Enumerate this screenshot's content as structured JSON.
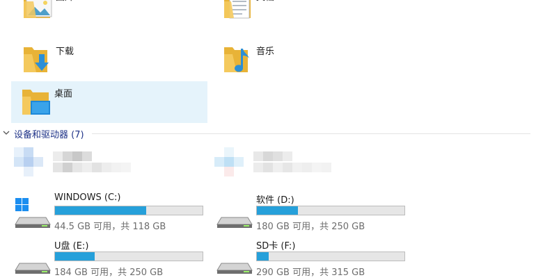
{
  "folders": [
    {
      "label": "图片",
      "icon": "pictures-folder-icon"
    },
    {
      "label": "文档",
      "icon": "documents-folder-icon"
    },
    {
      "label": "下载",
      "icon": "downloads-folder-icon"
    },
    {
      "label": "音乐",
      "icon": "music-folder-icon"
    },
    {
      "label": "桌面",
      "icon": "desktop-folder-icon",
      "selected": true
    }
  ],
  "devices_section": {
    "title": "设备和驱动器 (7)"
  },
  "drives": [
    {
      "name": "WINDOWS (C:)",
      "space": "44.5 GB 可用，共 118 GB",
      "used_fraction": 0.62,
      "icon": "windows-drive-icon"
    },
    {
      "name": "软件 (D:)",
      "space": "180 GB 可用，共 250 GB",
      "used_fraction": 0.28,
      "icon": "hard-drive-icon"
    },
    {
      "name": "U盘 (E:)",
      "space": "184 GB 可用，共 250 GB",
      "used_fraction": 0.27,
      "icon": "hard-drive-icon"
    },
    {
      "name": "SD卡 (F:)",
      "space": "290 GB 可用，共 315 GB",
      "used_fraction": 0.08,
      "icon": "hard-drive-icon"
    }
  ],
  "colors": {
    "accent": "#26a0da",
    "selection": "#e5f3fb",
    "section_title": "#1e3287",
    "folder": "#f0c14b"
  }
}
